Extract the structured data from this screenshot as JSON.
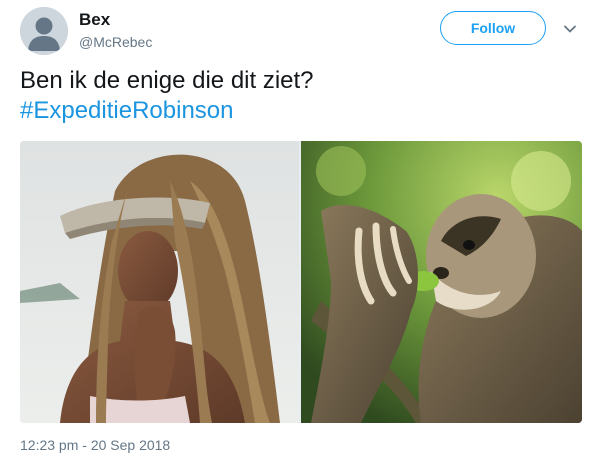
{
  "author": {
    "display_name": "Bex",
    "handle": "@McRebec",
    "avatar_icon": "default-profile-icon"
  },
  "actions": {
    "follow_label": "Follow",
    "more_icon": "chevron-down-icon"
  },
  "tweet": {
    "text": "Ben ik de enige die dit ziet?",
    "hashtag": "#ExpeditieRobinson"
  },
  "media": {
    "count": 2
  },
  "meta": {
    "timestamp": "12:23 pm - 20 Sep 2018"
  },
  "colors": {
    "accent": "#1da1f2",
    "hashtag": "#1b95e0",
    "secondary_text": "#657786",
    "primary_text": "#14171a"
  }
}
